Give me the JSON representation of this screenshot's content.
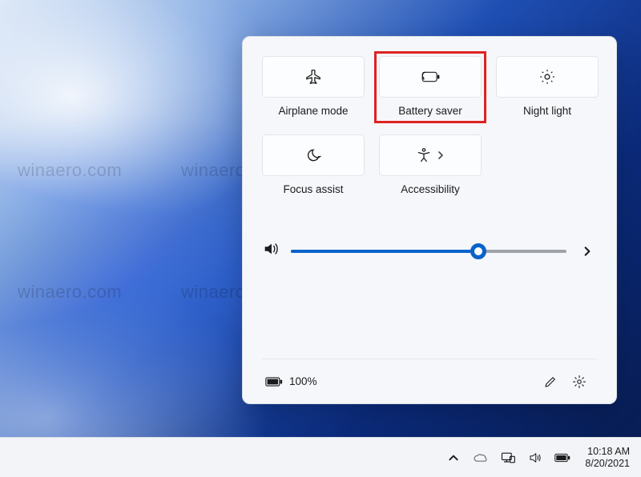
{
  "watermark_text": "winaero.com",
  "flyout": {
    "tiles": [
      {
        "id": "airplane-mode",
        "label": "Airplane mode",
        "icon": "airplane-icon",
        "has_chevron": false,
        "highlighted": false
      },
      {
        "id": "battery-saver",
        "label": "Battery saver",
        "icon": "battery-saver-icon",
        "has_chevron": false,
        "highlighted": true
      },
      {
        "id": "night-light",
        "label": "Night light",
        "icon": "night-light-icon",
        "has_chevron": false,
        "highlighted": false
      },
      {
        "id": "focus-assist",
        "label": "Focus assist",
        "icon": "focus-assist-icon",
        "has_chevron": false,
        "highlighted": false
      },
      {
        "id": "accessibility",
        "label": "Accessibility",
        "icon": "accessibility-icon",
        "has_chevron": true,
        "highlighted": false
      }
    ],
    "volume": {
      "percent": 68
    },
    "battery": {
      "text": "100%"
    }
  },
  "taskbar": {
    "time": "10:18 AM",
    "date": "8/20/2021"
  },
  "colors": {
    "accent": "#0a63c9",
    "panel": "#f5f7fb",
    "tile": "#fcfdfe",
    "highlight": "#d22"
  }
}
